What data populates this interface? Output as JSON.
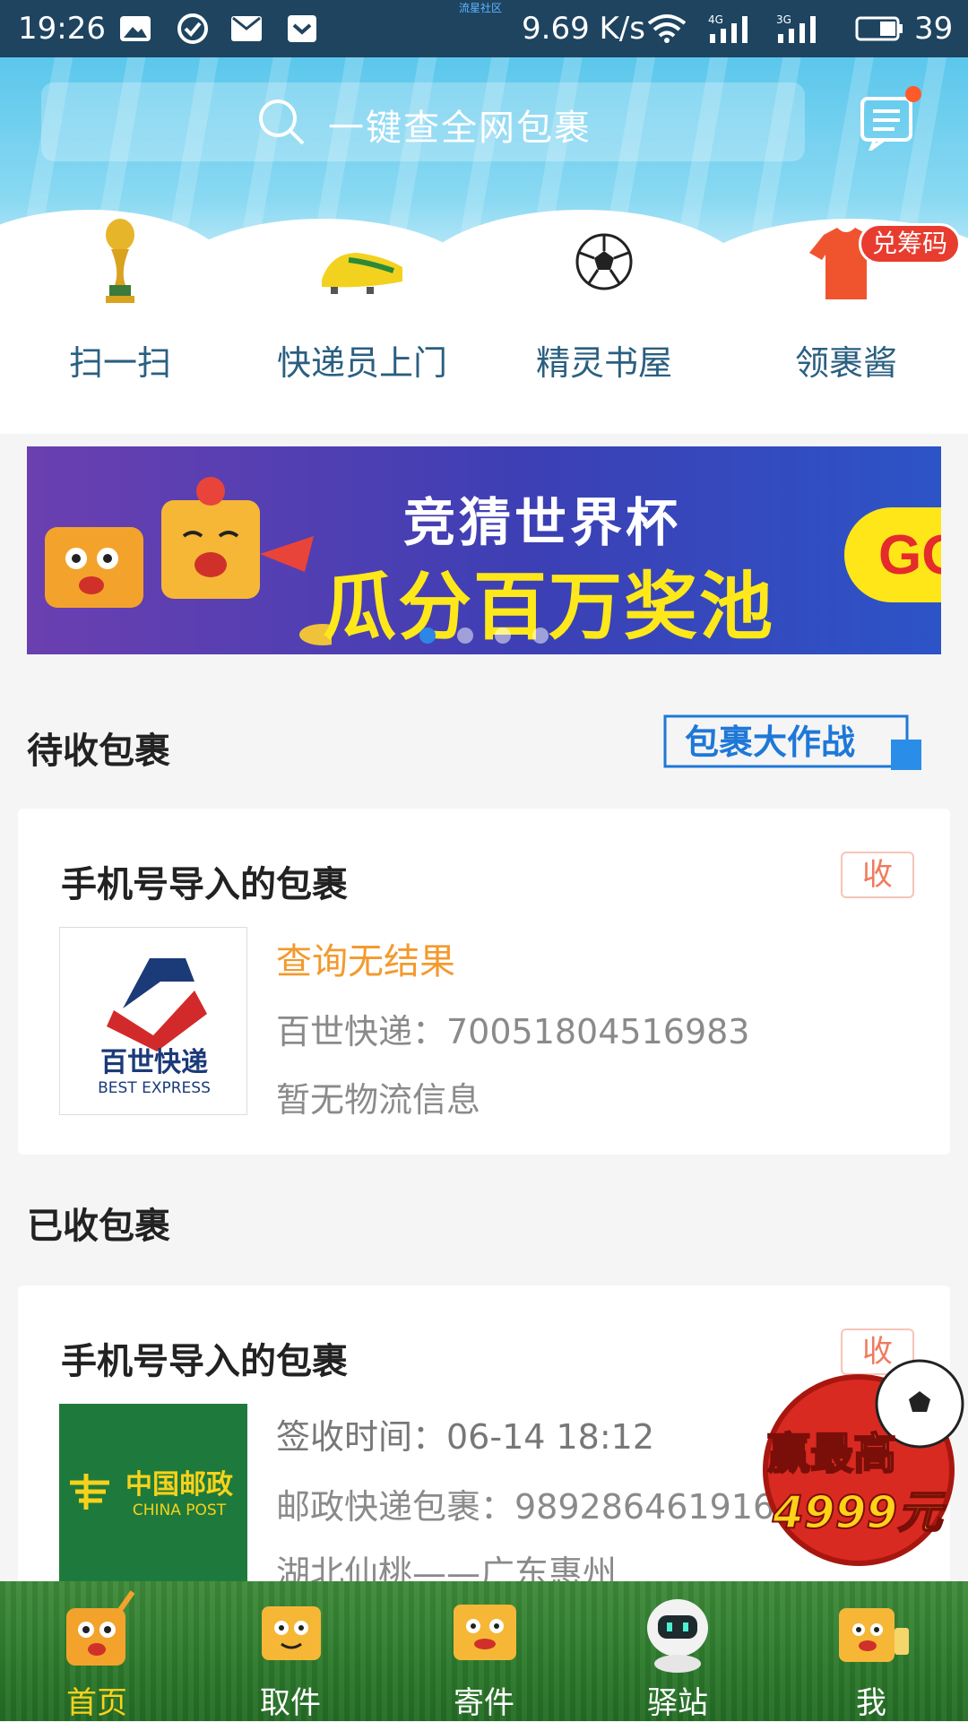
{
  "status_bar": {
    "time": "19:26",
    "carrier_note": "流星社区",
    "speed": "9.69 K/s",
    "battery": "39",
    "network_4g": "4G",
    "network_3g": "3G"
  },
  "search": {
    "placeholder": "一键查全网包裹"
  },
  "quick_actions": [
    {
      "label": "扫一扫",
      "icon": "trophy-icon"
    },
    {
      "label": "快递员上门",
      "icon": "soccer-shoe-icon"
    },
    {
      "label": "精灵书屋",
      "icon": "soccer-ball-icon"
    },
    {
      "label": "领裹酱",
      "icon": "jersey-icon"
    }
  ],
  "redeem_badge": "兑筹码",
  "banner": {
    "title": "竞猜世界杯",
    "subtitle": "瓜分百万奖池",
    "go": "GO",
    "active_dot": 0
  },
  "pending": {
    "section_title": "待收包裹",
    "promo_logo": "包裹大作战",
    "card": {
      "title": "手机号导入的包裹",
      "action": "收",
      "status": "查询无结果",
      "tracking": "百世快递：70051804516983",
      "detail": "暂无物流信息",
      "courier_logo_cn": "百世快递",
      "courier_logo_en": "BEST EXPRESS"
    }
  },
  "received": {
    "section_title": "已收包裹",
    "card": {
      "title": "手机号导入的包裹",
      "action": "收",
      "signed_time": "签收时间：06-14 18:12",
      "tracking": "邮政快递包裹：9892864619163",
      "route": "湖北仙桃——广东惠州",
      "courier_logo_cn": "中国邮政",
      "courier_logo_en": "CHINA POST"
    }
  },
  "promo_float": {
    "line1": "赢最高",
    "line2": "4999元"
  },
  "bottom_nav": [
    {
      "label": "首页",
      "active": true
    },
    {
      "label": "取件",
      "active": false
    },
    {
      "label": "寄件",
      "active": false
    },
    {
      "label": "驿站",
      "active": false
    },
    {
      "label": "我",
      "active": false
    }
  ],
  "colors": {
    "accent_orange": "#f39a2e",
    "nav_active": "#ffd21a",
    "banner_yellow": "#ffe81a",
    "go_red": "#e52b2b"
  }
}
